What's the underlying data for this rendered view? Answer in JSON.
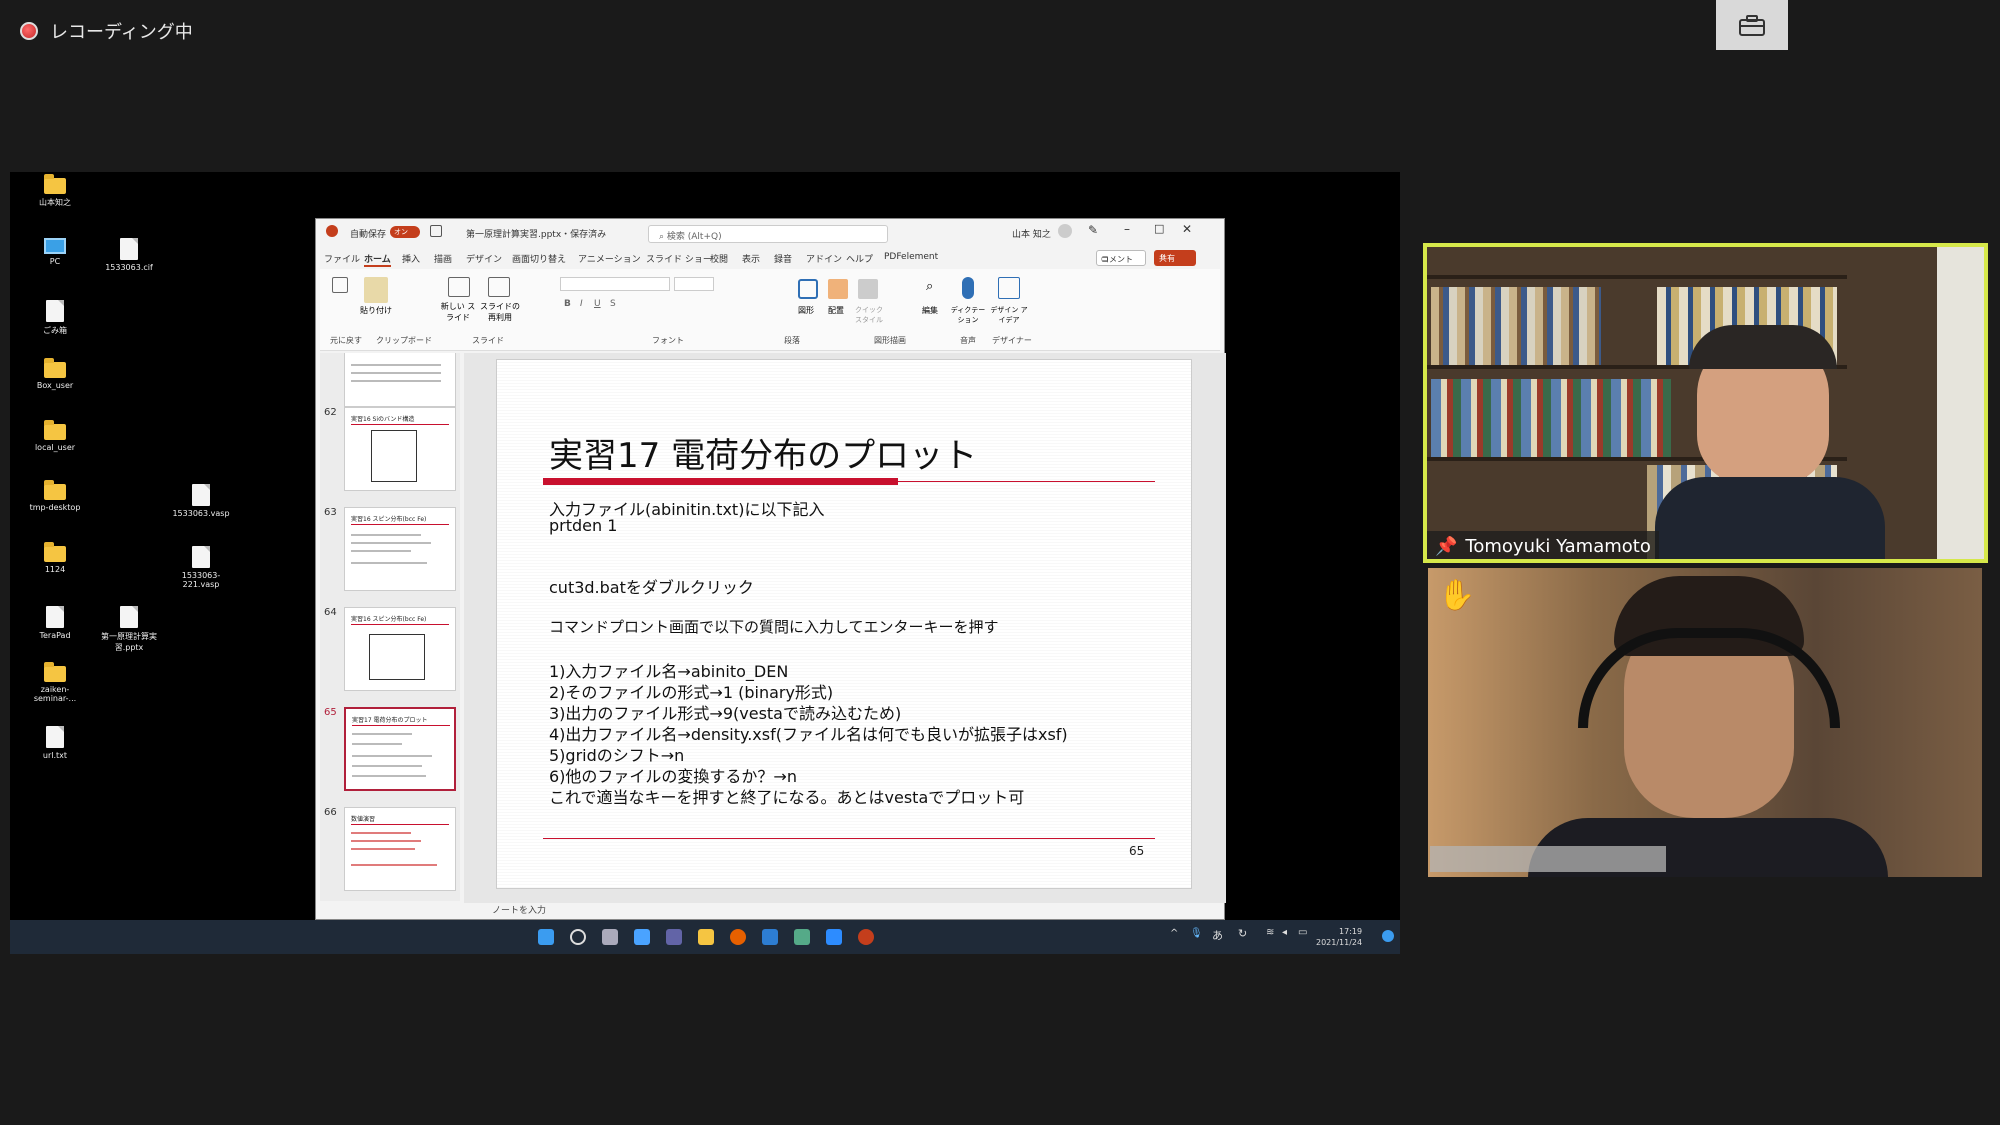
{
  "recording": {
    "label": "レコーディング中"
  },
  "desktop": {
    "icons": [
      "山本知之",
      "PC",
      "1533063.cif",
      "ごみ箱",
      "Box_user",
      "local_user",
      "tmp-desktop",
      "1533063.vasp",
      "1124",
      "1533063-221.vasp",
      "TeraPad",
      "第一原理計算実習.pptx",
      "zaiken-seminar-...",
      "url.txt"
    ]
  },
  "ppt": {
    "autosave_label": "自動保存",
    "autosave_state": "オン",
    "filename": "第一原理計算実習.pptx・保存済み",
    "search_placeholder": "検索 (Alt+Q)",
    "user": "山本 知之",
    "menu": [
      "ファイル",
      "ホーム",
      "挿入",
      "描画",
      "デザイン",
      "画面切り替え",
      "アニメーション",
      "スライド ショー",
      "校閲",
      "表示",
      "録音",
      "アドイン",
      "ヘルプ",
      "PDFelement"
    ],
    "comment_btn": "コメント",
    "share_btn": "共有",
    "ribbon_groups": [
      "元に戻す",
      "クリップボード",
      "スライド",
      "フォント",
      "段落",
      "図形描画",
      "音声",
      "デザイナー"
    ],
    "ribbon_labels": {
      "paste": "貼り付け",
      "new_slide": "新しい スライド",
      "reuse_slide": "スライドの 再利用",
      "shapes": "図形",
      "arrange": "配置",
      "quick_styles": "クイック スタイル",
      "edit": "編集",
      "dictate": "ディクテー ション",
      "design_ideas": "デザイン アイデア"
    },
    "notes_placeholder": "ノートを入力",
    "thumbnails": [
      {
        "num": "62",
        "title": "実習16 Siのバンド構造"
      },
      {
        "num": "63",
        "title": "実習16 スピン分布(bcc Fe)"
      },
      {
        "num": "64",
        "title": "実習16 スピン分布(bcc Fe)"
      },
      {
        "num": "65",
        "title": "実習17 電荷分布のプロット"
      },
      {
        "num": "66",
        "title": "数値演習"
      }
    ],
    "slide": {
      "title": "実習17 電荷分布のプロット",
      "lines": [
        "入力ファイル(abinitin.txt)に以下記入",
        "prtden 1",
        "cut3d.batをダブルクリック",
        "コマンドプロント画面で以下の質問に入力してエンターキーを押す",
        "1)入力ファイル名→abinito_DEN",
        "2)そのファイルの形式→1 (binary形式)",
        "3)出力のファイル形式→9(vestaで読み込むため)",
        "4)出力ファイル名→density.xsf(ファイル名は何でも良いが拡張子はxsf)",
        "5)gridのシフト→n",
        "6)他のファイルの変換するか？→n",
        "これで適当なキーを押すと終了になる。あとはvestaでプロット可"
      ],
      "page_number": "65"
    }
  },
  "taskbar": {
    "time": "17:19",
    "date": "2021/11/24",
    "ime": "あ"
  },
  "participants": [
    {
      "name": "Tomoyuki Yamamoto",
      "active_speaker": true
    },
    {
      "name": "",
      "hand_raised": true
    }
  ],
  "colors": {
    "accent_red": "#c8102e",
    "active_speaker_border": "#d6e84a",
    "ppt_brand": "#c43e1c"
  }
}
